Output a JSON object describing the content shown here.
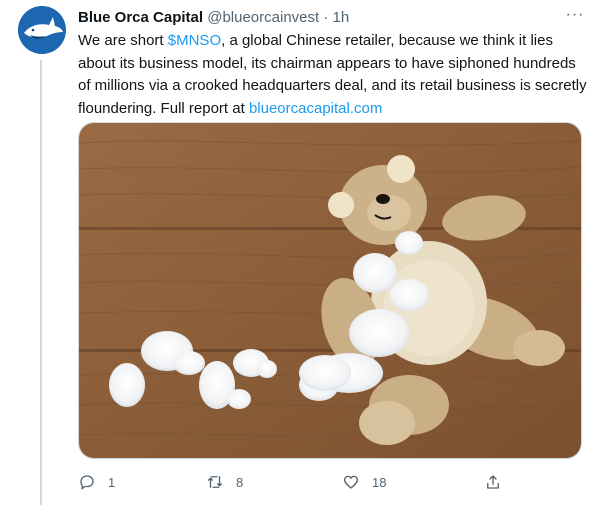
{
  "tweet": {
    "author_name": "Blue Orca Capital",
    "author_handle": "@blueorcainvest",
    "separator": "·",
    "timestamp": "1h",
    "text_before_ticker": "We are short ",
    "ticker": "$MNSO",
    "text_after_ticker": ", a global Chinese retailer, because we think it lies about its business model, its chairman appears to have siphoned hundreds of millions via a crooked headquarters deal, and its retail business is secretly floundering.  Full report at ",
    "report_link": "blueorcacapital.com",
    "more_label": "···"
  },
  "actions": {
    "reply_count": "1",
    "retweet_count": "8",
    "like_count": "18",
    "share_count": ""
  },
  "icons": {
    "reply": "reply-icon",
    "retweet": "retweet-icon",
    "like": "heart-icon",
    "share": "share-icon",
    "more": "more-options-icon"
  },
  "colors": {
    "link": "#1d9bf0",
    "muted": "#536471",
    "avatar_bg": "#1d67b0"
  }
}
